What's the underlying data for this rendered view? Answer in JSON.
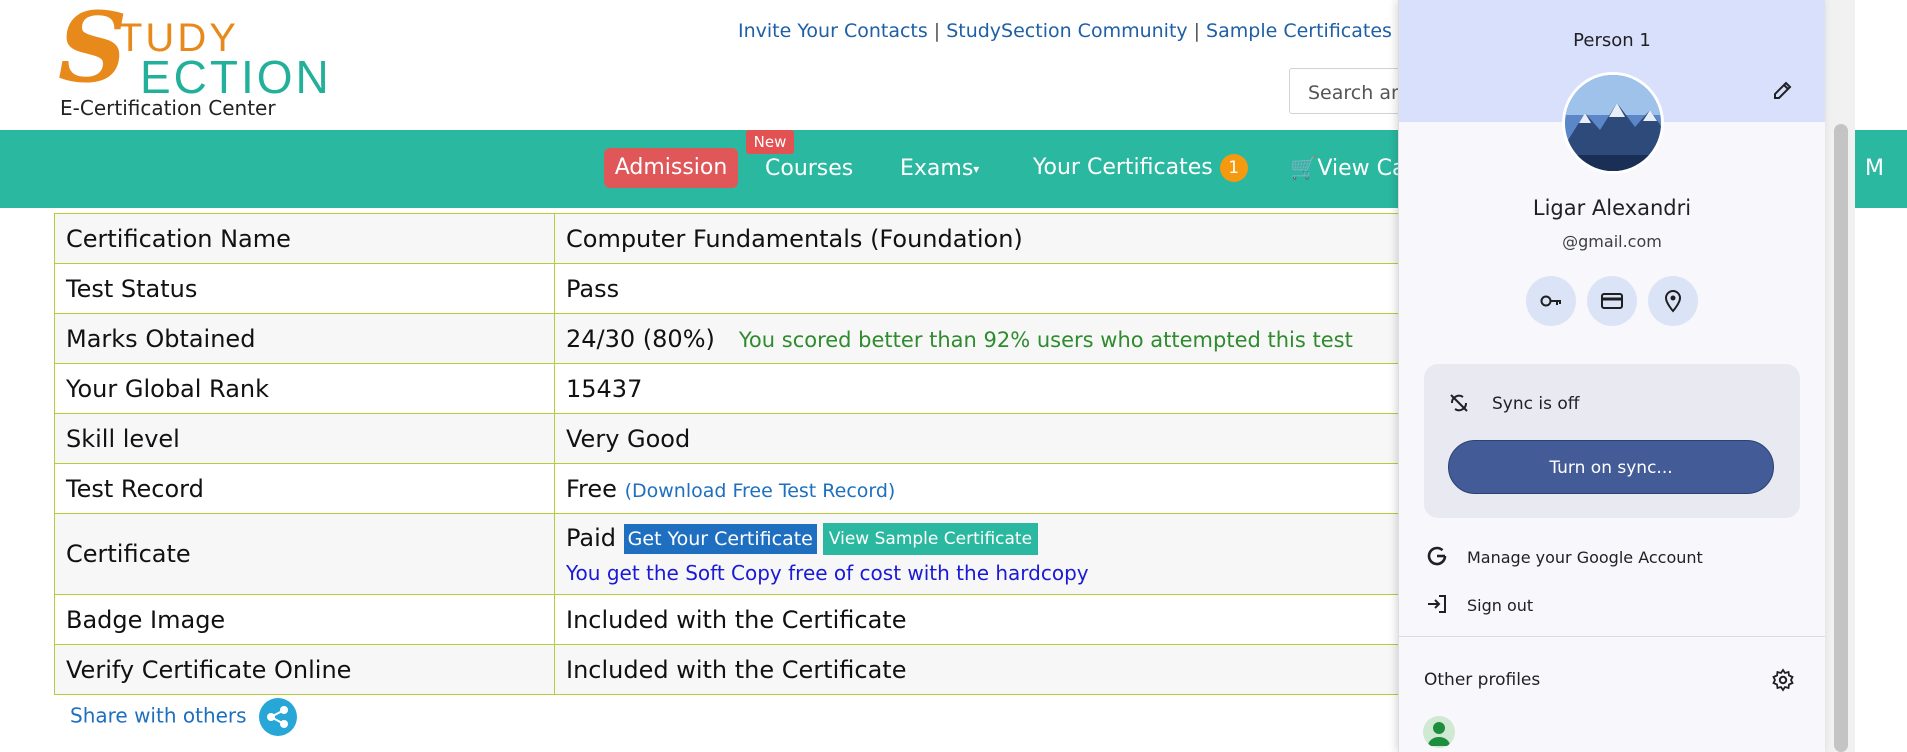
{
  "header": {
    "logo_letter": "S",
    "logo_tudy": "TUDY",
    "logo_ection": "ECTION",
    "logo_subtitle": "E-Certification Center",
    "links": [
      "Invite Your Contacts",
      "StudySection Community",
      "Sample Certificates"
    ],
    "search_placeholder": "Search an"
  },
  "nav": {
    "admission": "Admission",
    "new_badge": "New",
    "courses": "Courses",
    "exams": "Exams",
    "certificates": "Your Certificates",
    "certificates_count": "1",
    "cart": "View Ca",
    "right_cut": "M"
  },
  "results": {
    "rows": [
      {
        "label": "Certification Name",
        "value": "Computer Fundamentals (Foundation)"
      },
      {
        "label": "Test Status",
        "value": "Pass"
      },
      {
        "label": "Marks Obtained",
        "value": "24/30 (80%)",
        "note": "You scored better than 92% users who attempted this test"
      },
      {
        "label": "Your Global Rank",
        "value": "15437"
      },
      {
        "label": "Skill level",
        "value": "Very Good"
      },
      {
        "label": "Test Record",
        "value": "Free",
        "link": "(Download Free Test Record)"
      },
      {
        "label": "Certificate",
        "value": "Paid",
        "btn1": "Get Your Certificate",
        "btn2": "View Sample Certificate",
        "note": "You get the Soft Copy free of cost with the hardcopy"
      },
      {
        "label": "Badge Image",
        "value": "Included with the Certificate"
      },
      {
        "label": "Verify Certificate Online",
        "value": "Included with the Certificate"
      }
    ]
  },
  "share": {
    "label": "Share with others"
  },
  "profile_panel": {
    "profile_label": "Person 1",
    "user_name": "Ligar Alexandri",
    "user_email": "@gmail.com",
    "quick_icons": [
      "key-icon",
      "card-icon",
      "location-icon"
    ],
    "sync_status": "Sync is off",
    "sync_button": "Turn on sync...",
    "manage_account": "Manage your Google Account",
    "sign_out": "Sign out",
    "other_profiles": "Other profiles"
  },
  "colors": {
    "brand_teal": "#2bb8a0",
    "brand_orange": "#e8891c",
    "admission_red": "#e0575a",
    "link_blue": "#1e5fa6",
    "sync_button_blue": "#435c97",
    "panel_header": "#d9e0fb"
  }
}
